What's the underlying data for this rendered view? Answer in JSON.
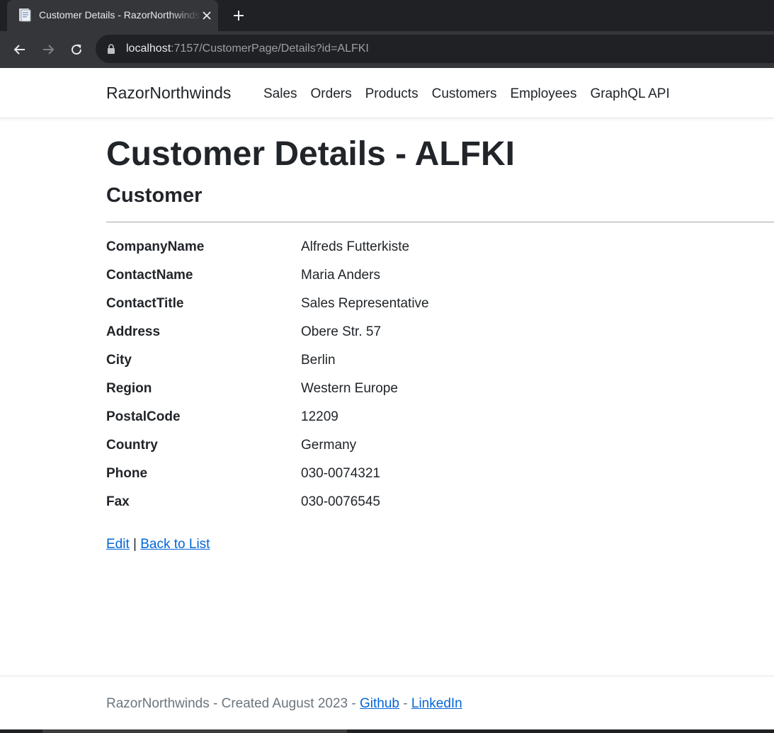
{
  "browser": {
    "tab_title": "Customer Details - RazorNorthwinds",
    "url_host": "localhost",
    "url_path": ":7157/CustomerPage/Details?id=ALFKI"
  },
  "header": {
    "brand": "RazorNorthwinds",
    "nav": [
      {
        "label": "Sales"
      },
      {
        "label": "Orders"
      },
      {
        "label": "Products"
      },
      {
        "label": "Customers"
      },
      {
        "label": "Employees"
      },
      {
        "label": "GraphQL API"
      }
    ]
  },
  "main": {
    "title": "Customer Details - ALFKI",
    "subtitle": "Customer",
    "details": [
      {
        "label": "CompanyName",
        "value": "Alfreds Futterkiste"
      },
      {
        "label": "ContactName",
        "value": "Maria Anders"
      },
      {
        "label": "ContactTitle",
        "value": "Sales Representative"
      },
      {
        "label": "Address",
        "value": "Obere Str. 57"
      },
      {
        "label": "City",
        "value": "Berlin"
      },
      {
        "label": "Region",
        "value": "Western Europe"
      },
      {
        "label": "PostalCode",
        "value": "12209"
      },
      {
        "label": "Country",
        "value": "Germany"
      },
      {
        "label": "Phone",
        "value": "030-0074321"
      },
      {
        "label": "Fax",
        "value": "030-0076545"
      }
    ],
    "actions": {
      "edit": "Edit",
      "separator": "|",
      "back": "Back to List"
    }
  },
  "footer": {
    "text": "RazorNorthwinds - Created August 2023 - ",
    "github": "Github",
    "dash": " - ",
    "linkedin": "LinkedIn"
  },
  "colors": {
    "link": "#0366d6",
    "chrome_dark": "#202124",
    "chrome_tab": "#35363a"
  }
}
